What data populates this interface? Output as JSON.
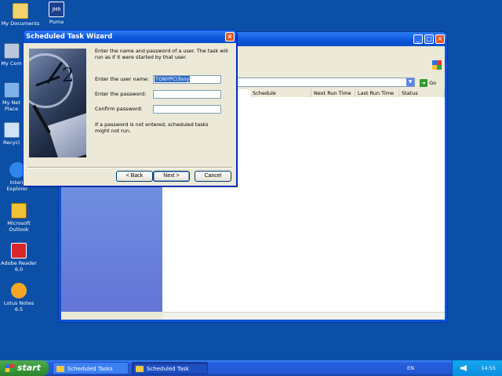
{
  "desktop": {
    "icons": [
      {
        "label": "My Documents"
      },
      {
        "label": "Puma",
        "sublabel": "JMR"
      },
      {
        "label": "My Com"
      },
      {
        "label": "My Net",
        "line2": "Place"
      },
      {
        "label": "Recycl"
      },
      {
        "label": "Intern",
        "line2": "Explorer"
      },
      {
        "label": "Microsoft",
        "line2": "Outlook"
      },
      {
        "label": "Adobe Reader",
        "line2": "6.0"
      },
      {
        "label": "Lotus Notes",
        "line2": "6.5"
      }
    ]
  },
  "explorer": {
    "go_label": "Go",
    "columns": [
      "Schedule",
      "Next Run Time",
      "Last Run Time",
      "Status"
    ]
  },
  "wizard": {
    "title": "Scheduled Task Wizard",
    "intro": "Enter the name and password of a user.  The task will run as if it were started by that user.",
    "username_label": "Enter the user name:",
    "username_value": "TONYPC\\Tony",
    "password_label": "Enter the password:",
    "password_value": "",
    "confirm_label": "Confirm password:",
    "confirm_value": "",
    "note": "If a password is not entered, scheduled tasks might not run.",
    "back_label": "< Back",
    "next_label": "Next >",
    "cancel_label": "Cancel"
  },
  "taskbar": {
    "start_label": "start",
    "tasks": [
      {
        "label": "Scheduled Tasks"
      },
      {
        "label": "Scheduled Task Wizard"
      }
    ],
    "language": "EN",
    "clock": "14:55"
  }
}
